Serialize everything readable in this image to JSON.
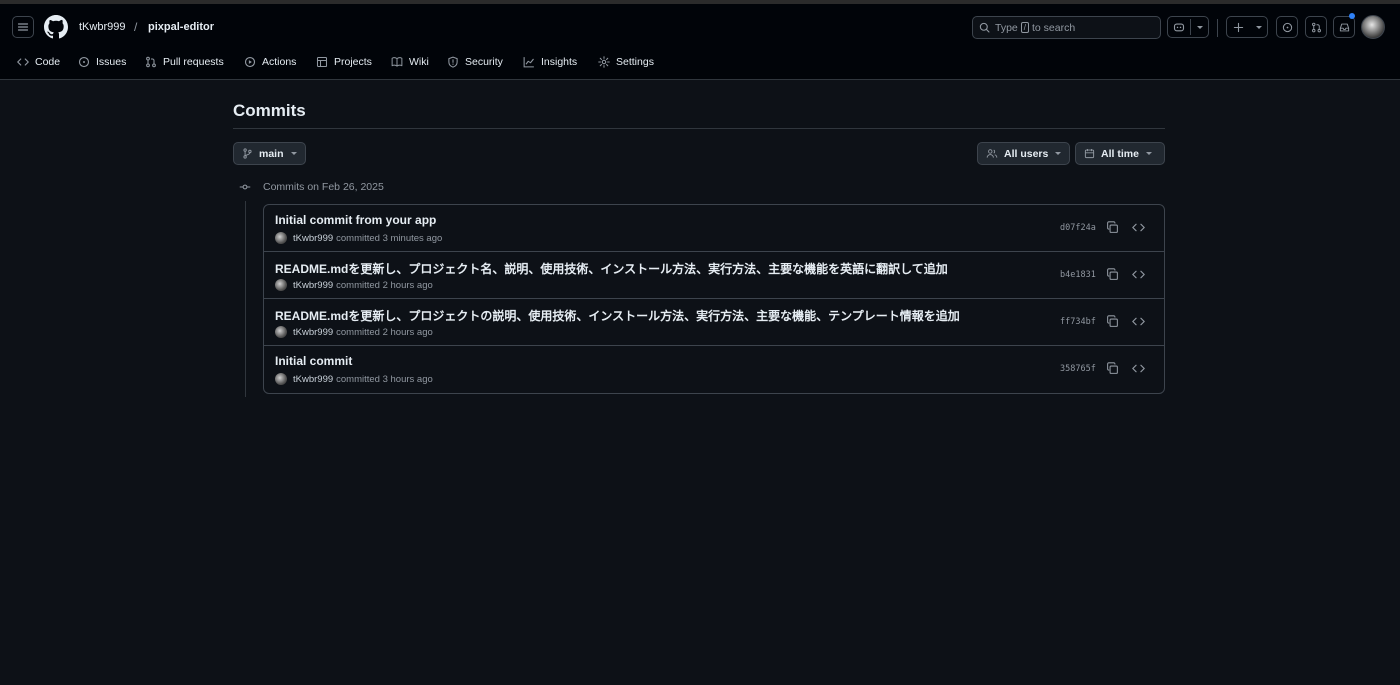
{
  "header": {
    "owner": "tKwbr999",
    "separator": "/",
    "repo": "pixpal-editor",
    "search_prefix": "Type",
    "search_key": "/",
    "search_suffix": "to search"
  },
  "tabs": [
    {
      "label": "Code",
      "icon": "code-icon"
    },
    {
      "label": "Issues",
      "icon": "issue-opened-icon"
    },
    {
      "label": "Pull requests",
      "icon": "git-pull-request-icon"
    },
    {
      "label": "Actions",
      "icon": "play-icon"
    },
    {
      "label": "Projects",
      "icon": "table-icon"
    },
    {
      "label": "Wiki",
      "icon": "book-icon"
    },
    {
      "label": "Security",
      "icon": "shield-icon"
    },
    {
      "label": "Insights",
      "icon": "graph-icon"
    },
    {
      "label": "Settings",
      "icon": "gear-icon"
    }
  ],
  "page": {
    "title": "Commits",
    "branch": "main",
    "users_filter": "All users",
    "time_filter": "All time",
    "group_label": "Commits on Feb 26, 2025"
  },
  "commits": [
    {
      "message": "Initial commit from your app",
      "author": "tKwbr999",
      "when": "committed 3 minutes ago",
      "sha": "d07f24a"
    },
    {
      "message": "README.mdを更新し、プロジェクト名、説明、使用技術、インストール方法、実行方法、主要な機能を英語に翻訳して追加",
      "author": "tKwbr999",
      "when": "committed 2 hours ago",
      "sha": "b4e1831"
    },
    {
      "message": "README.mdを更新し、プロジェクトの説明、使用技術、インストール方法、実行方法、主要な機能、テンプレート情報を追加",
      "author": "tKwbr999",
      "when": "committed 2 hours ago",
      "sha": "ff734bf"
    },
    {
      "message": "Initial commit",
      "author": "tKwbr999",
      "when": "committed 3 hours ago",
      "sha": "358765f"
    }
  ],
  "colors": {
    "background": "#0d1117",
    "header": "#010409",
    "border": "#3d444d",
    "text": "#e6edf3",
    "muted": "#9198a1",
    "notification": "#2f81f7"
  }
}
